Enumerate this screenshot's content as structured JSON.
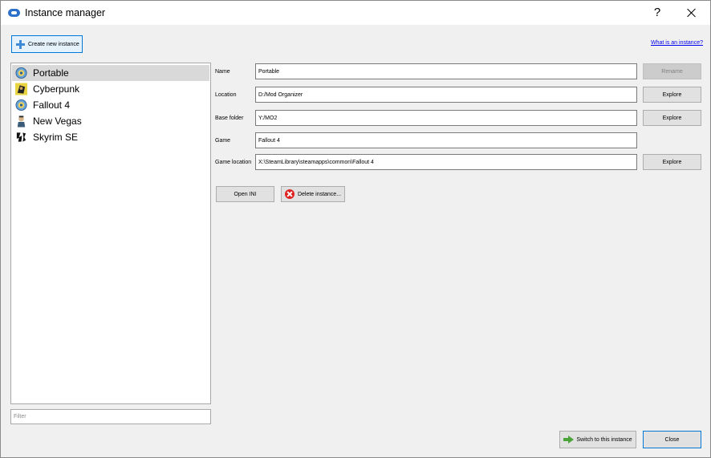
{
  "window": {
    "title": "Instance manager",
    "help": "?"
  },
  "toolbar": {
    "create_label": "Create new instance",
    "what_link": "What is an instance?"
  },
  "instances": [
    {
      "label": "Portable",
      "icon": "fallout-vault-boy-icon",
      "selected": true
    },
    {
      "label": "Cyberpunk",
      "icon": "cyberpunk-icon",
      "selected": false
    },
    {
      "label": "Fallout 4",
      "icon": "fallout-vault-boy-icon",
      "selected": false
    },
    {
      "label": "New Vegas",
      "icon": "new-vegas-icon",
      "selected": false
    },
    {
      "label": "Skyrim SE",
      "icon": "skyrim-icon",
      "selected": false
    }
  ],
  "filter": {
    "placeholder": "Filter"
  },
  "details": {
    "name_label": "Name",
    "name_value": "Portable",
    "rename_label": "Rename",
    "location_label": "Location",
    "location_value": "D:/Mod Organizer",
    "location_explore": "Explore",
    "base_label": "Base folder",
    "base_value": "Y:/MO2",
    "base_explore": "Explore",
    "game_label": "Game",
    "game_value": "Fallout 4",
    "gameloc_label": "Game location",
    "gameloc_value": "X:\\SteamLibrary\\steamapps\\common\\Fallout 4",
    "gameloc_explore": "Explore"
  },
  "actions": {
    "open_ini": "Open INI",
    "delete": "Delete instance..."
  },
  "footer": {
    "switch": "Switch to this instance",
    "close": "Close"
  },
  "colors": {
    "accent": "#0078d7",
    "selected_bg": "#d9d9d9",
    "link": "#0000ee"
  }
}
